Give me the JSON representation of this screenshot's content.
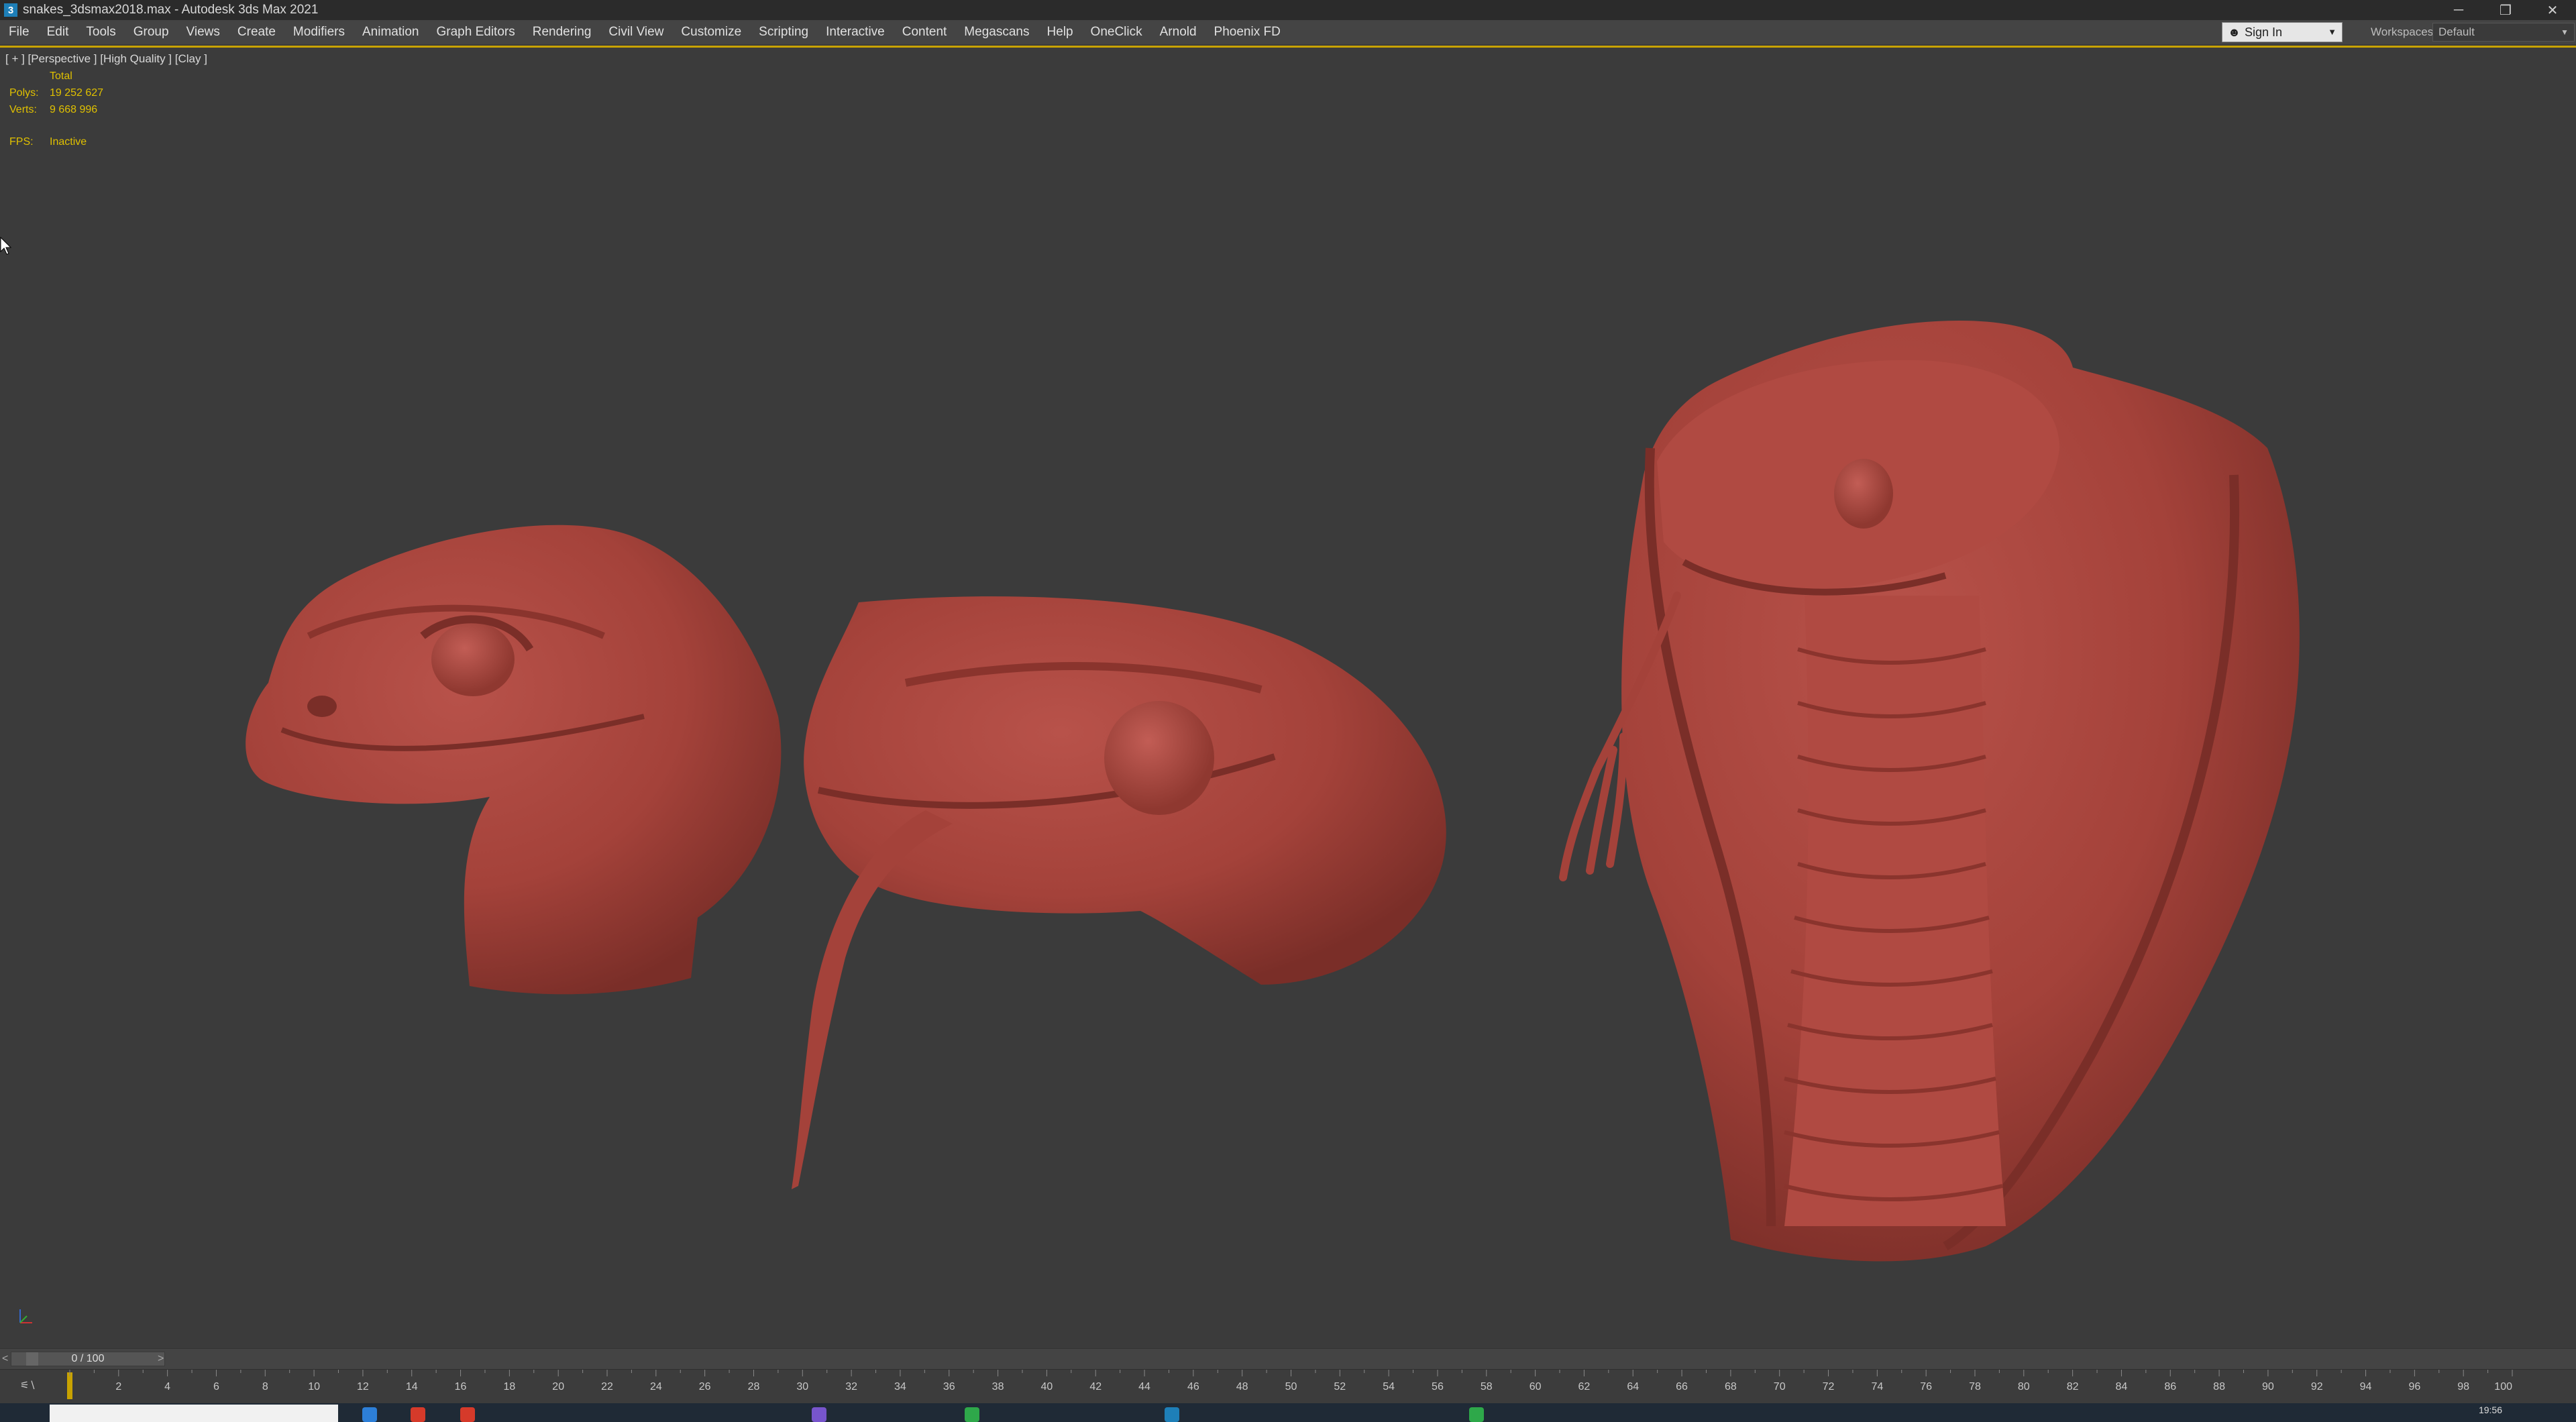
{
  "window": {
    "title": "snakes_3dsmax2018.max - Autodesk 3ds Max 2021",
    "app_icon": "3",
    "minimize": "─",
    "restore": "❐",
    "close": "✕"
  },
  "menu": [
    "File",
    "Edit",
    "Tools",
    "Group",
    "Views",
    "Create",
    "Modifiers",
    "Animation",
    "Graph Editors",
    "Rendering",
    "Civil View",
    "Customize",
    "Scripting",
    "Interactive",
    "Content",
    "Megascans",
    "Help",
    "OneClick",
    "Arnold",
    "Phoenix FD"
  ],
  "account": {
    "sign_in": "Sign In",
    "workspaces_label": "Workspaces:",
    "workspace": "Default"
  },
  "viewport": {
    "label": "[ + ] [Perspective ] [High Quality ] [Clay ]",
    "stats": {
      "header": "Total",
      "polys_label": "Polys:",
      "polys": "19 252 627",
      "verts_label": "Verts:",
      "verts": "9 668 996",
      "fps_label": "FPS:",
      "fps": "Inactive"
    },
    "model_color": "#a8433b",
    "background_color": "#3b3b3b",
    "active_border_color": "#c8a200"
  },
  "timeline": {
    "slider_text": "0 / 100",
    "prev": "<",
    "next": ">",
    "ticks": [
      "2",
      "4",
      "6",
      "8",
      "10",
      "12",
      "14",
      "16",
      "18",
      "20",
      "22",
      "24",
      "26",
      "28",
      "30",
      "32",
      "34",
      "36",
      "38",
      "40",
      "42",
      "44",
      "46",
      "48",
      "50",
      "52",
      "54",
      "56",
      "58",
      "60",
      "62",
      "64",
      "66",
      "68",
      "70",
      "72",
      "74",
      "76",
      "78",
      "80",
      "82",
      "84",
      "86",
      "88",
      "90",
      "92",
      "94",
      "96",
      "98",
      "100"
    ]
  },
  "taskbar": {
    "time": "19:56"
  }
}
